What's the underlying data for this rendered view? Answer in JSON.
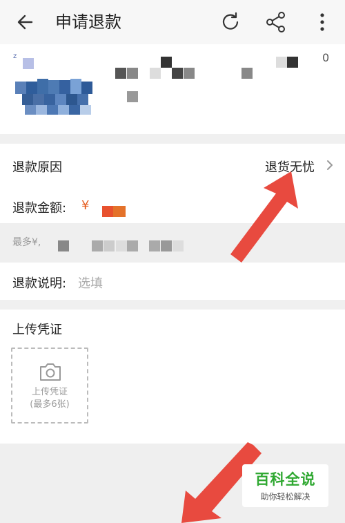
{
  "header": {
    "title": "申请退款",
    "back_icon": "back-arrow-icon",
    "refresh_icon": "refresh-icon",
    "share_icon": "share-icon",
    "more_icon": "more-vertical-icon"
  },
  "product": {
    "image": "blurred-product-thumbnail",
    "corner_char": "0"
  },
  "refund": {
    "reason_label": "退款原因",
    "reason_value": "退货无忧",
    "amount_label": "退款金额:",
    "currency_symbol": "¥",
    "max_hint": "最多¥,",
    "explain_label": "退款说明:",
    "explain_placeholder": "选填"
  },
  "upload": {
    "section_title": "上传凭证",
    "button_line1": "上传凭证",
    "button_line2": "(最多6张)"
  },
  "watermark": {
    "title": "百科全说",
    "subtitle": "助你轻松解决"
  },
  "colors": {
    "accent_red": "#e84a3f",
    "price_orange": "#e55a1c",
    "watermark_green": "#2fa831"
  }
}
